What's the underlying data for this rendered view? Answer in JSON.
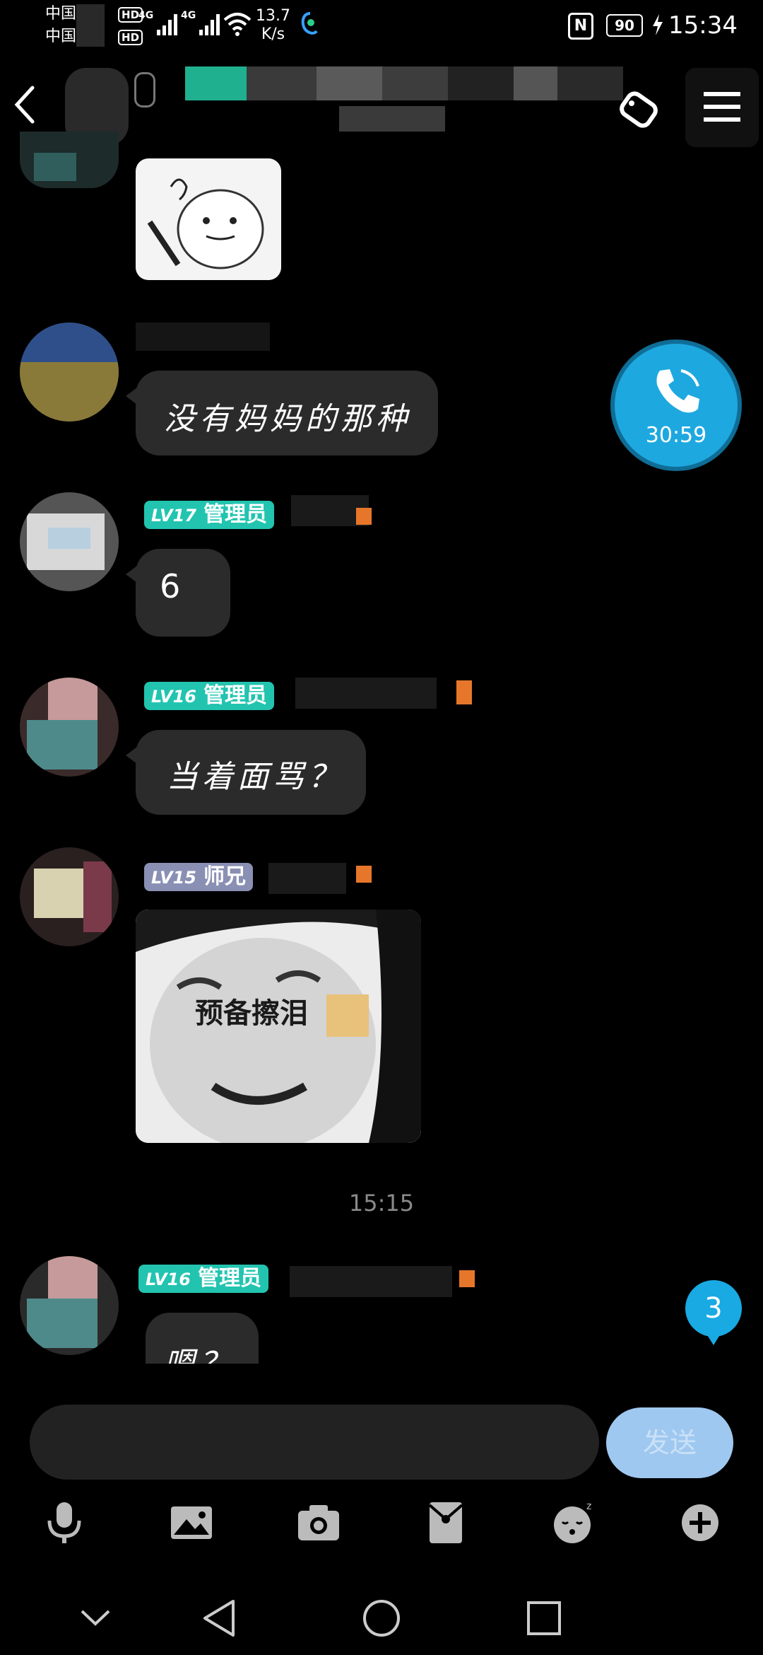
{
  "status_bar": {
    "carrier_1": "中国",
    "carrier_2": "中国",
    "hd_1": "HD",
    "hd_2": "HD",
    "net_1": "4G",
    "net_2": "4G",
    "speed_value": "13.7",
    "speed_unit": "K/s",
    "nfc": "N",
    "battery": "90",
    "time": "15:34"
  },
  "call": {
    "timer": "30:59"
  },
  "messages": {
    "m1_text": "没有妈妈的那种",
    "m2_level": "LV17",
    "m2_title": "管理员",
    "m2_text": "6",
    "m3_level": "LV16",
    "m3_title": "管理员",
    "m3_text": "当着面骂？",
    "m4_level": "LV15",
    "m4_title": "师兄",
    "m4_sticker_caption": "预备擦泪",
    "time_divider": "15:15",
    "m5_level": "LV16",
    "m5_title": "管理员",
    "m5_text": "嗯？"
  },
  "unread_count": "3",
  "input": {
    "send_label": "发送"
  },
  "icons": {
    "back": "chevron-left-icon",
    "menu": "hamburger-icon",
    "phone": "phone-icon",
    "voice": "microphone-icon",
    "image": "image-icon",
    "camera": "camera-icon",
    "red_packet": "red-packet-icon",
    "emoji": "emoji-icon",
    "plus": "plus-icon"
  },
  "colors": {
    "admin_badge": "#22c4b0",
    "senior_badge": "#8a90b4",
    "bubble": "#2b2b2b",
    "call_button": "#1ea8e0",
    "send_button": "#9fc8f0"
  }
}
